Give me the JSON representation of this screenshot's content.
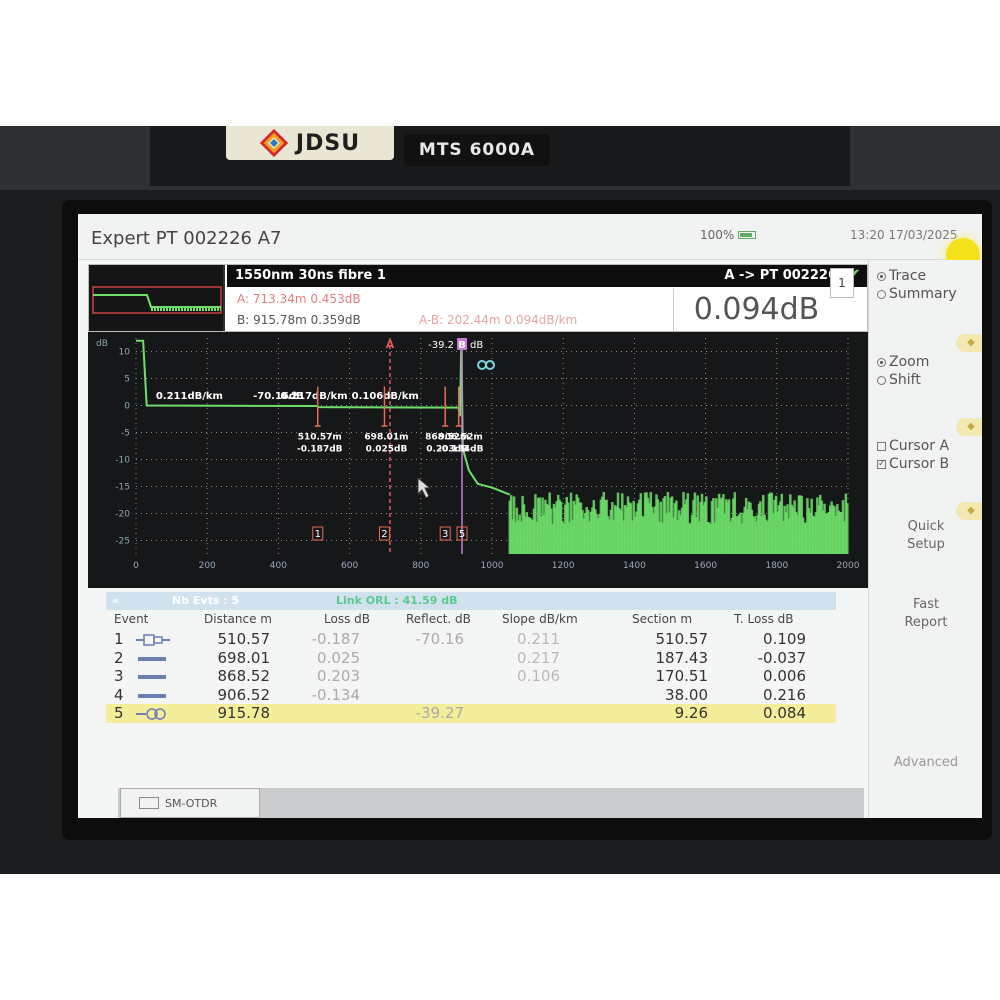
{
  "device": {
    "brand": "JDSU",
    "model": "MTS 6000A"
  },
  "titlebar": {
    "title": "Expert PT 002226 A7",
    "battery": "100%",
    "clock": "13:20  17/03/2025"
  },
  "info": {
    "left": "1550nm  30ns  fibre  1",
    "right": "A -> PT 002226",
    "cursor_a": "A: 713.34m  0.453dB",
    "cursor_b": "B: 915.78m  0.359dB",
    "cursor_ab": "A-B: 202.44m  0.094dB/km",
    "value": "0.094dB",
    "page": "1"
  },
  "graph": {
    "y_unit": "dB",
    "y_ticks": [
      "10",
      "5",
      "0",
      "-5",
      "-10",
      "-15",
      "-20",
      "-25"
    ],
    "x_ticks": [
      "0",
      "200",
      "400",
      "600",
      "800",
      "1000",
      "1200",
      "1400",
      "1600",
      "1800",
      "2000"
    ],
    "marker_a": "A",
    "marker_b": "B",
    "reflect_label": "-39.2",
    "reflect_unit": "dB",
    "slopes": [
      "0.211dB/km",
      "-70.16dB",
      "0.217dB/km",
      "0.106dB/km"
    ],
    "event_labels": [
      {
        "dist": "510.57m",
        "loss": "-0.187dB"
      },
      {
        "dist": "698.01m",
        "loss": "0.025dB"
      },
      {
        "dist": "868.52m",
        "loss": "0.203dB"
      },
      {
        "dist": "906.52m",
        "loss": "-0.134dB"
      }
    ],
    "event_numbers": [
      "1",
      "2",
      "3",
      "5"
    ]
  },
  "events_header": {
    "collapse": "«",
    "nb_evts": "Nb Evts : 5",
    "link": "Link ORL : 41.59 dB"
  },
  "table": {
    "columns": [
      "Event",
      "Distance  m",
      "Loss  dB",
      "Reflect. dB",
      "Slope  dB/km",
      "Section m",
      "T. Loss  dB"
    ],
    "rows": [
      {
        "event": "1",
        "icon": "reflective-event-icon",
        "distance": "510.57",
        "loss": "-0.187",
        "reflect": "-70.16",
        "slope": "0.211",
        "section": "510.57",
        "tloss": "0.109"
      },
      {
        "event": "2",
        "icon": "splice-event-icon",
        "distance": "698.01",
        "loss": "0.025",
        "reflect": "",
        "slope": "0.217",
        "section": "187.43",
        "tloss": "-0.037"
      },
      {
        "event": "3",
        "icon": "splice-event-icon",
        "distance": "868.52",
        "loss": "0.203",
        "reflect": "",
        "slope": "0.106",
        "section": "170.51",
        "tloss": "0.006"
      },
      {
        "event": "4",
        "icon": "splice-event-icon",
        "distance": "906.52",
        "loss": "-0.134",
        "reflect": "",
        "slope": "",
        "section": "38.00",
        "tloss": "0.216"
      },
      {
        "event": "5",
        "icon": "fiber-end-icon",
        "distance": "915.78",
        "loss": "",
        "reflect": "-39.27",
        "slope": "",
        "section": "9.26",
        "tloss": "0.084"
      }
    ]
  },
  "tab": {
    "label": "SM-OTDR"
  },
  "sidebar": {
    "trace": "Trace",
    "summary": "Summary",
    "zoom": "Zoom",
    "shift": "Shift",
    "cursor_a": "Cursor A",
    "cursor_b": "Cursor B",
    "quick_setup_1": "Quick",
    "quick_setup_2": "Setup",
    "fast_report_1": "Fast",
    "fast_report_2": "Report",
    "advanced": "Advanced"
  },
  "colors": {
    "trace": "#6ee06a",
    "cursor_a": "#e05a5a",
    "cursor_b": "#c87ad8",
    "event_marker": "#e86b4f",
    "highlight": "#f4ee9a"
  }
}
